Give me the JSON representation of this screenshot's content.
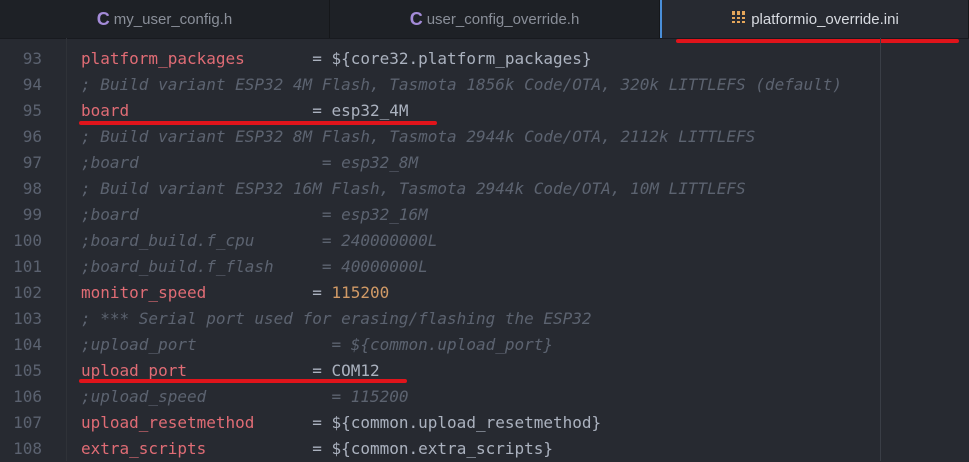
{
  "tabs": [
    {
      "icon": "C",
      "label": "my_user_config.h",
      "active": false
    },
    {
      "icon": "C",
      "label": "user_config_override.h",
      "active": false
    },
    {
      "icon": "ini",
      "label": "platformio_override.ini",
      "active": true
    }
  ],
  "lines": [
    {
      "n": "93",
      "parts": [
        {
          "t": "platform_packages",
          "c": "key"
        },
        {
          "t": "       = ${core32.platform_packages}",
          "c": "op"
        }
      ]
    },
    {
      "n": "94",
      "parts": [
        {
          "t": "; Build variant ESP32 4M Flash, Tasmota 1856k Code/OTA, 320k LITTLEFS (default)",
          "c": "cmt"
        }
      ]
    },
    {
      "n": "95",
      "parts": [
        {
          "t": "board",
          "c": "key"
        },
        {
          "t": "                   = esp32_4M",
          "c": "op"
        }
      ]
    },
    {
      "n": "96",
      "parts": [
        {
          "t": "; Build variant ESP32 8M Flash, Tasmota 2944k Code/OTA, 2112k LITTLEFS",
          "c": "cmt"
        }
      ]
    },
    {
      "n": "97",
      "parts": [
        {
          "t": ";board                   = esp32_8M",
          "c": "cmt"
        }
      ]
    },
    {
      "n": "98",
      "parts": [
        {
          "t": "; Build variant ESP32 16M Flash, Tasmota 2944k Code/OTA, 10M LITTLEFS",
          "c": "cmt"
        }
      ]
    },
    {
      "n": "99",
      "parts": [
        {
          "t": ";board                   = esp32_16M",
          "c": "cmt"
        }
      ]
    },
    {
      "n": "100",
      "parts": [
        {
          "t": ";board_build.f_cpu       = 240000000L",
          "c": "cmt"
        }
      ]
    },
    {
      "n": "101",
      "parts": [
        {
          "t": ";board_build.f_flash     = 40000000L",
          "c": "cmt"
        }
      ]
    },
    {
      "n": "102",
      "parts": [
        {
          "t": "monitor_speed",
          "c": "key"
        },
        {
          "t": "           = ",
          "c": "op"
        },
        {
          "t": "115200",
          "c": "num"
        }
      ]
    },
    {
      "n": "103",
      "parts": [
        {
          "t": "; *** Serial port used for erasing/flashing the ESP32",
          "c": "cmt"
        }
      ]
    },
    {
      "n": "104",
      "parts": [
        {
          "t": ";upload_port              = ${common.upload_port}",
          "c": "cmt"
        }
      ]
    },
    {
      "n": "105",
      "parts": [
        {
          "t": "upload_port",
          "c": "key"
        },
        {
          "t": "             = COM12",
          "c": "op"
        }
      ]
    },
    {
      "n": "106",
      "parts": [
        {
          "t": ";upload_speed             = 115200",
          "c": "cmt"
        }
      ]
    },
    {
      "n": "107",
      "parts": [
        {
          "t": "upload_resetmethod",
          "c": "key"
        },
        {
          "t": "      = ${common.upload_resetmethod}",
          "c": "op"
        }
      ]
    },
    {
      "n": "108",
      "parts": [
        {
          "t": "extra_scripts",
          "c": "key"
        },
        {
          "t": "           = ${common.extra_scripts}",
          "c": "op"
        }
      ]
    }
  ]
}
